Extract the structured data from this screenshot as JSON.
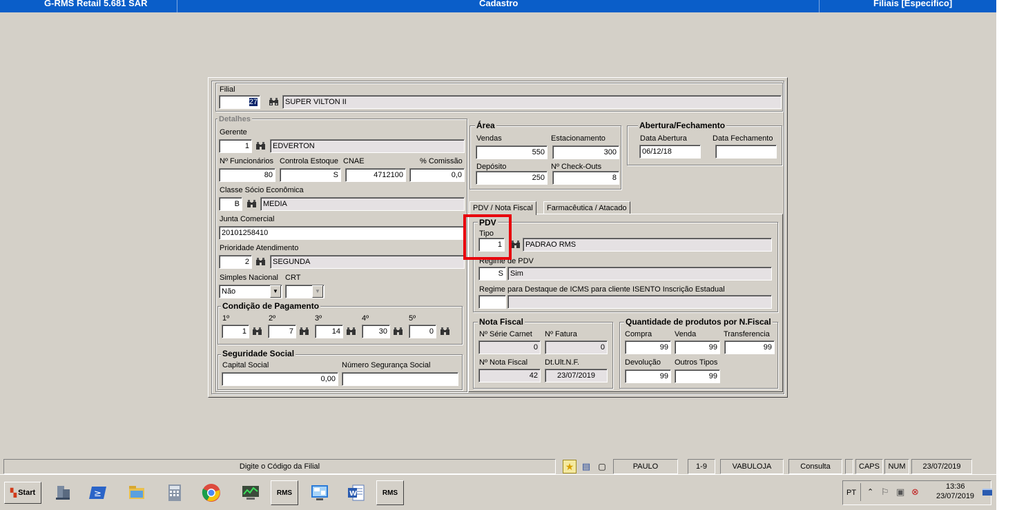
{
  "titlebar": {
    "left": "G-RMS Retail 5.681 SAR",
    "center": "Cadastro",
    "right": "Filiais [Especifico]"
  },
  "filial": {
    "label": "Filial",
    "code": "27",
    "name": "SUPER VILTON II"
  },
  "detalhes": {
    "legend": "Detalhes",
    "gerente_label": "Gerente",
    "gerente_code": "1",
    "gerente_name": "EDVERTON",
    "funcionarios_label": "Nº Funcionários",
    "funcionarios": "80",
    "controla_estoque_label": "Controla Estoque",
    "controla_estoque": "S",
    "cnae_label": "CNAE",
    "cnae": "4712100",
    "comissao_label": "% Comissão",
    "comissao": "0,0",
    "classe_label": "Classe Sócio Econômica",
    "classe_code": "B",
    "classe_name": "MEDIA",
    "junta_label": "Junta Comercial",
    "junta": "20101258410",
    "prioridade_label": "Prioridade Atendimento",
    "prioridade_code": "2",
    "prioridade_name": "SEGUNDA",
    "simples_label": "Simples Nacional",
    "simples_value": "Não",
    "crt_label": "CRT",
    "crt_value": ""
  },
  "condicao": {
    "legend": "Condição de Pagamento",
    "labels": [
      "1º",
      "2º",
      "3º",
      "4º",
      "5º"
    ],
    "values": [
      "1",
      "7",
      "14",
      "30",
      "0"
    ]
  },
  "seguridade": {
    "legend": "Seguridade Social",
    "capital_label": "Capital Social",
    "capital": "0,00",
    "numero_label": "Número Segurança Social",
    "numero": ""
  },
  "area": {
    "legend": "Área",
    "vendas_label": "Vendas",
    "vendas": "550",
    "estacionamento_label": "Estacionamento",
    "estacionamento": "300",
    "deposito_label": "Depósito",
    "deposito": "250",
    "checkouts_label": "Nº Check-Outs",
    "checkouts": "8"
  },
  "abertura": {
    "legend": "Abertura/Fechamento",
    "abertura_label": "Data Abertura",
    "abertura": "06/12/18",
    "fechamento_label": "Data Fechamento",
    "fechamento": ""
  },
  "tabs": {
    "pdv": "PDV / Nota Fiscal",
    "farma": "Farmacêutica / Atacado"
  },
  "pdv": {
    "legend": "PDV",
    "tipo_label": "Tipo",
    "tipo_code": "1",
    "tipo_name": "PADRAO RMS",
    "regime_label": "Regime de PDV",
    "regime_code": "S",
    "regime_name": "Sim",
    "destaque_label": "Regime para Destaque de ICMS para cliente ISENTO Inscrição Estadual",
    "destaque_code": "",
    "destaque_name": ""
  },
  "nota": {
    "legend": "Nota Fiscal",
    "serie_label": "Nº Série Carnet",
    "serie": "0",
    "fatura_label": "Nº Fatura",
    "fatura": "0",
    "nota_label": "Nº Nota Fiscal",
    "nota": "42",
    "dtult_label": "Dt.Ult.N.F.",
    "dtult": "23/07/2019"
  },
  "quantidade": {
    "legend": "Quantidade de produtos por N.Fiscal",
    "compra_label": "Compra",
    "compra": "99",
    "venda_label": "Venda",
    "venda": "99",
    "transf_label": "Transferencia",
    "transf": "99",
    "devolucao_label": "Devolução",
    "devolucao": "99",
    "outros_label": "Outros Tipos",
    "outros": "99"
  },
  "statusbar": {
    "hint": "Digite o Código da Filial",
    "user": "PAULO",
    "range": "1-9",
    "loja": "VABULOJA",
    "mode": "Consulta",
    "caps": "CAPS",
    "num": "NUM",
    "date": "23/07/2019"
  },
  "taskbar": {
    "start": "Start",
    "rms1": "RMS",
    "rms2": "RMS",
    "lang": "PT",
    "time": "13:36",
    "date": "23/07/2019"
  }
}
